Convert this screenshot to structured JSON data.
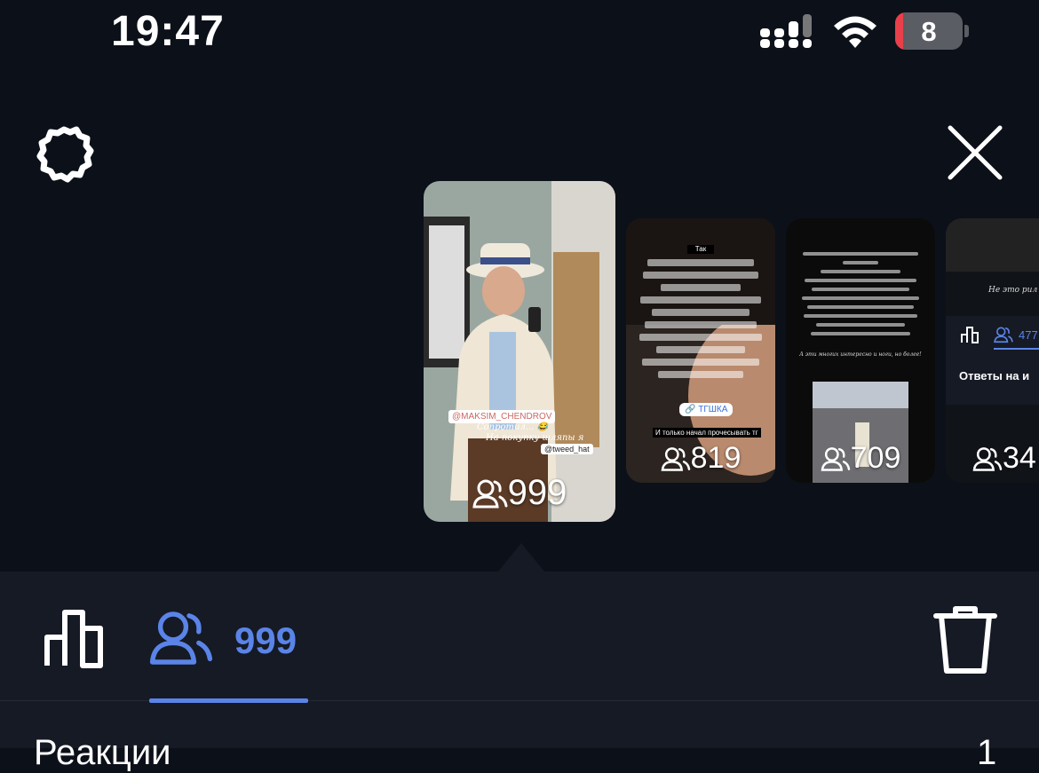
{
  "status_bar": {
    "time": "19:47",
    "battery_level": "8",
    "icons": [
      "signal-icon",
      "wifi-icon",
      "battery-icon"
    ]
  },
  "header": {
    "settings_icon": "gear-icon",
    "close_icon": "close-icon"
  },
  "stories": [
    {
      "views": "999",
      "selected": true,
      "captions": [
        "@MAKSIM_CHENDROV",
        "Сопротил... 😂",
        "На покупку шляпы я",
        "@tweed_hat"
      ]
    },
    {
      "views": "819",
      "selected": false,
      "captions": [
        "Так",
        "Кино и Никита, 25",
        "🔗 ТГШКА",
        "И только начал прочесывать тг"
      ]
    },
    {
      "views": "709",
      "selected": false,
      "captions": [
        "А эти многих интересно и ноги, но более!"
      ]
    },
    {
      "views": "34",
      "selected": false,
      "captions": [
        "Не это рил просто",
        "Ответы на и",
        "477"
      ]
    }
  ],
  "panel": {
    "stats_icon": "bar-chart-icon",
    "viewers_icon": "viewers-icon",
    "viewers_count": "999",
    "delete_icon": "trash-icon",
    "section_title": "Реакции",
    "section_count": "1"
  },
  "colors": {
    "background": "#0c1019",
    "panel": "#151a24",
    "accent": "#5b84e8",
    "battery_low": "#e8404a"
  }
}
